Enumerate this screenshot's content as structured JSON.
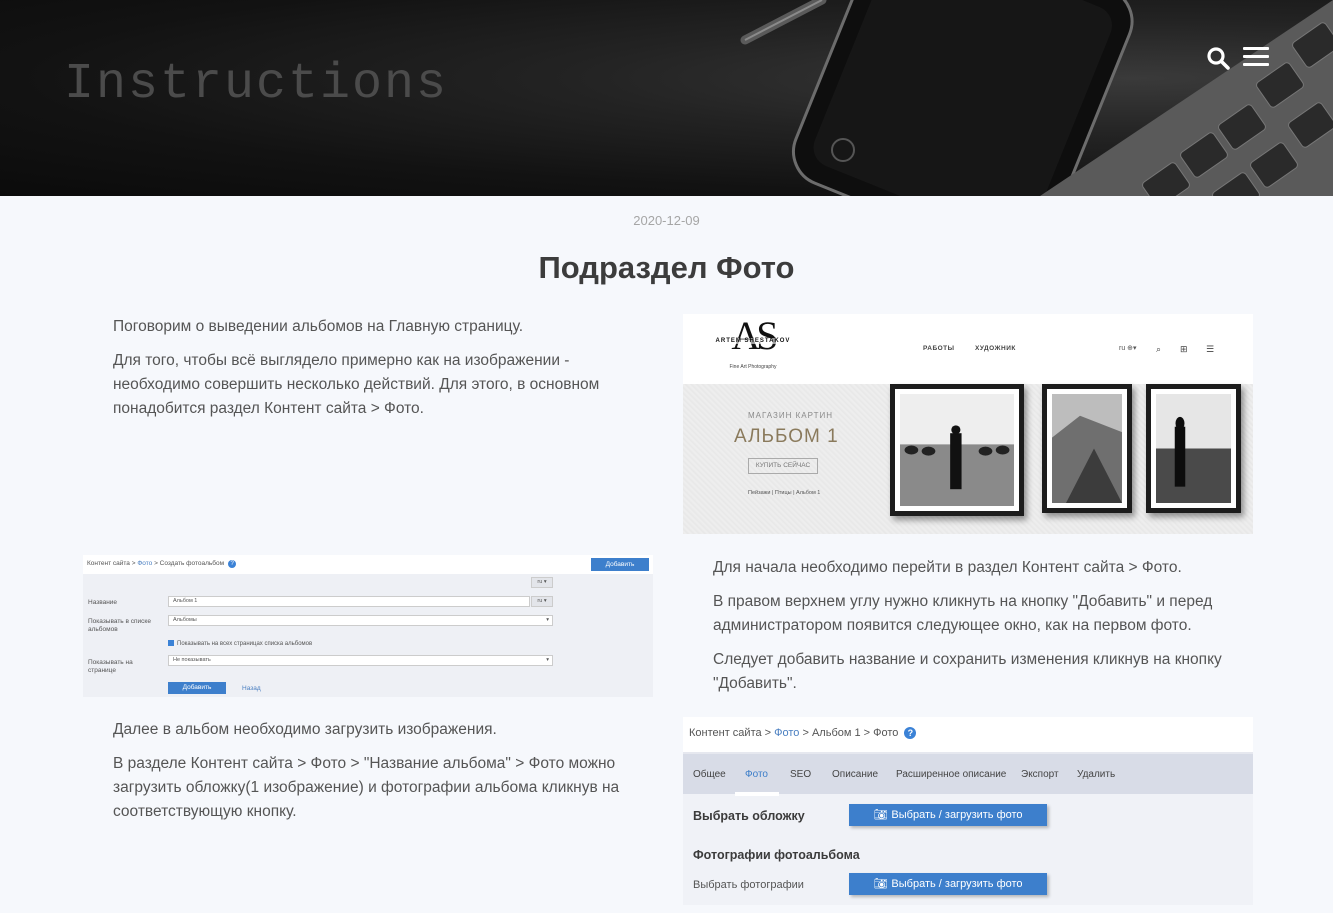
{
  "hero": {
    "title": "Instructions"
  },
  "post": {
    "date": "2020-12-09",
    "title": "Подраздел Фото",
    "block1": [
      "Поговорим о выведении альбомов на Главную страницу.",
      "Для того, чтобы всё выглядело примерно как на изображении - необходимо совершить несколько действий. Для этого, в основном понадобится раздел Контент сайта > Фото."
    ],
    "block2": [
      "Для начала необходимо перейти в раздел Контент сайта > Фото.",
      "В правом верхнем углу нужно кликнуть на кнопку \"Добавить\" и перед администратором появится следующее окно, как на первом фото.",
      "Следует добавить название и сохранить изменения кликнув на кнопку \"Добавить\"."
    ],
    "block3": [
      "Далее в альбом необходимо загрузить изображения.",
      "В разделе Контент сайта > Фото > \"Название альбома\" > Фото можно загрузить обложку(1 изображение) и фотографии альбома кликнув на соответствующую кнопку."
    ]
  },
  "shot1": {
    "logo_mark": "AS",
    "logo_name": "ARTEM SHESTAKOV",
    "logo_sub": "Fine Art Photography",
    "nav": [
      "РАБОТЫ",
      "ХУДОЖНИК"
    ],
    "lang": "ru",
    "shop": "МАГАЗИН КАРТИН",
    "album": "АЛЬБОМ 1",
    "buy": "КУПИТЬ СЕЙЧАС",
    "crumbs": "Пейзажи | Птицы | Альбом 1"
  },
  "shot2": {
    "crumb_a": "Контент сайта >",
    "crumb_b": "Фото",
    "crumb_c": "> Создать фотоальбом",
    "add": "Добавить",
    "lang": "ru",
    "name_label": "Название",
    "name_value": "Альбом 1",
    "show_label": "Показывать в списке альбомов",
    "show_value": "Альбомы",
    "check_label": "Показывать на всех страницах списка альбомов",
    "page_label": "Показывать на странице",
    "page_value": "Не показывать",
    "submit": "Добавить",
    "back": "Назад"
  },
  "shot3": {
    "crumb_a": "Контент сайта >",
    "crumb_b": "Фото",
    "crumb_c": "> Альбом 1 > Фото",
    "tabs": [
      "Общее",
      "Фото",
      "SEO",
      "Описание",
      "Расширенное описание",
      "Экспорт",
      "Удалить"
    ],
    "cover_label": "Выбрать обложку",
    "photos_title": "Фотографии фотоальбома",
    "photos_label": "Выбрать фотографии",
    "upload_btn": "Выбрать / загрузить фото"
  }
}
